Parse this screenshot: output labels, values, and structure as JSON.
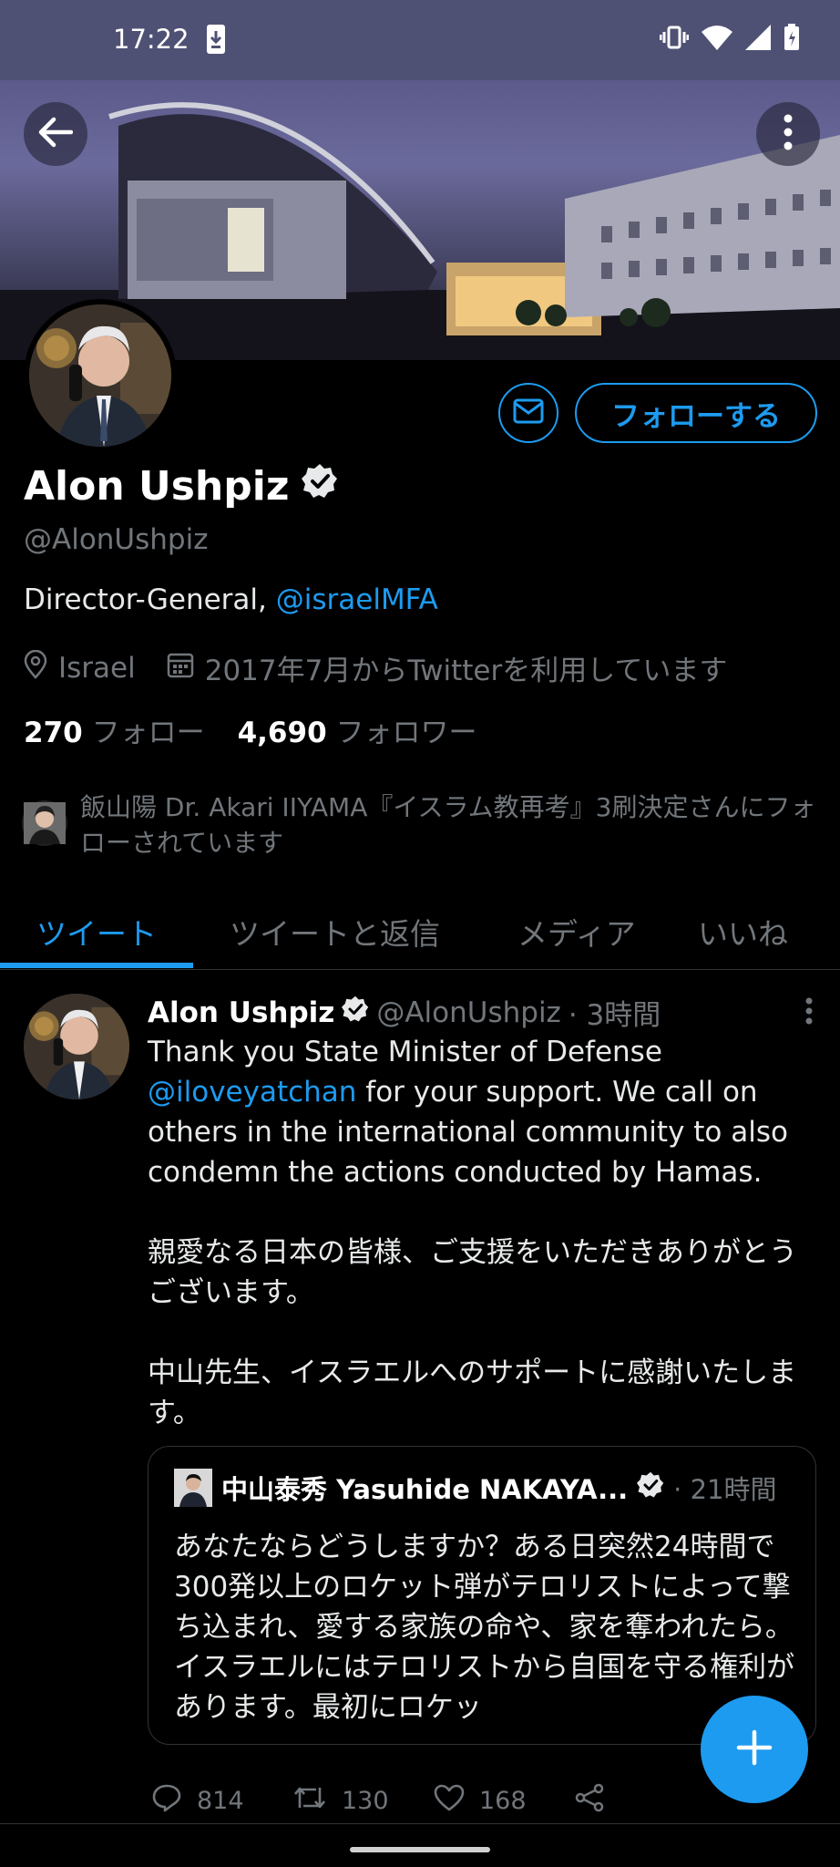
{
  "status_bar": {
    "time": "17:22"
  },
  "profile": {
    "name": "Alon Ushpiz",
    "handle": "@AlonUshpiz",
    "bio_text": "Director-General, ",
    "bio_mention": "@israelMFA",
    "location": "Israel",
    "joined": "2017年7月からTwitterを利用しています",
    "following_count": "270",
    "following_label": "フォロー",
    "followers_count": "4,690",
    "followers_label": "フォロワー",
    "followed_by": "飯山陽 Dr. Akari IIYAMA『イスラム教再考』3刷決定さんにフォローされています",
    "follow_button": "フォローする"
  },
  "tabs": [
    {
      "label": "ツイート"
    },
    {
      "label": "ツイートと返信"
    },
    {
      "label": "メディア"
    },
    {
      "label": "いいね"
    }
  ],
  "tweet": {
    "name": "Alon Ushpiz",
    "handle": "@AlonUshpiz",
    "time": "· 3時間",
    "body_1a": "Thank you State Minister of Defense ",
    "body_mention": "@iloveyatchan",
    "body_1b": " for your support. We call on others in the international community to also condemn the actions conducted by Hamas.",
    "body_2": "親愛なる日本の皆様、ご支援をいただきありがとうございます。",
    "body_3": "中山先生、イスラエルへのサポートに感謝いたします。",
    "quote": {
      "name": "中山泰秀 Yasuhide NAKAYA...",
      "time": "· 21時間",
      "body": "あなたならどうしますか？ある日突然24時間で300発以上のロケット弾がテロリストによって撃ち込まれ、愛する家族の命や、家を奪われたら。イスラエルにはテロリストから自国を守る権利があります。最初にロケッ"
    },
    "replies": "814",
    "retweets": "130",
    "likes": "168"
  },
  "colors": {
    "accent": "#1d9bf0",
    "background": "#000000",
    "muted": "#71767b"
  }
}
